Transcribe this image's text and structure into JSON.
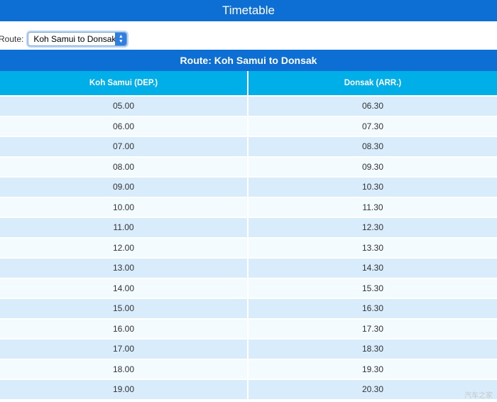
{
  "header": {
    "title": "Timetable"
  },
  "route_selector": {
    "label": "Route:",
    "selected": "Koh Samui to Donsak"
  },
  "route_heading": "Route: Koh Samui to Donsak",
  "table": {
    "columns": [
      "Koh Samui (DEP.)",
      "Donsak (ARR.)"
    ],
    "rows": [
      [
        "05.00",
        "06.30"
      ],
      [
        "06.00",
        "07.30"
      ],
      [
        "07.00",
        "08.30"
      ],
      [
        "08.00",
        "09.30"
      ],
      [
        "09.00",
        "10.30"
      ],
      [
        "10.00",
        "11.30"
      ],
      [
        "11.00",
        "12.30"
      ],
      [
        "12.00",
        "13.30"
      ],
      [
        "13.00",
        "14.30"
      ],
      [
        "14.00",
        "15.30"
      ],
      [
        "15.00",
        "16.30"
      ],
      [
        "16.00",
        "17.30"
      ],
      [
        "17.00",
        "18.30"
      ],
      [
        "18.00",
        "19.30"
      ],
      [
        "19.00",
        "20.30"
      ]
    ]
  },
  "watermark": "汽车之家"
}
